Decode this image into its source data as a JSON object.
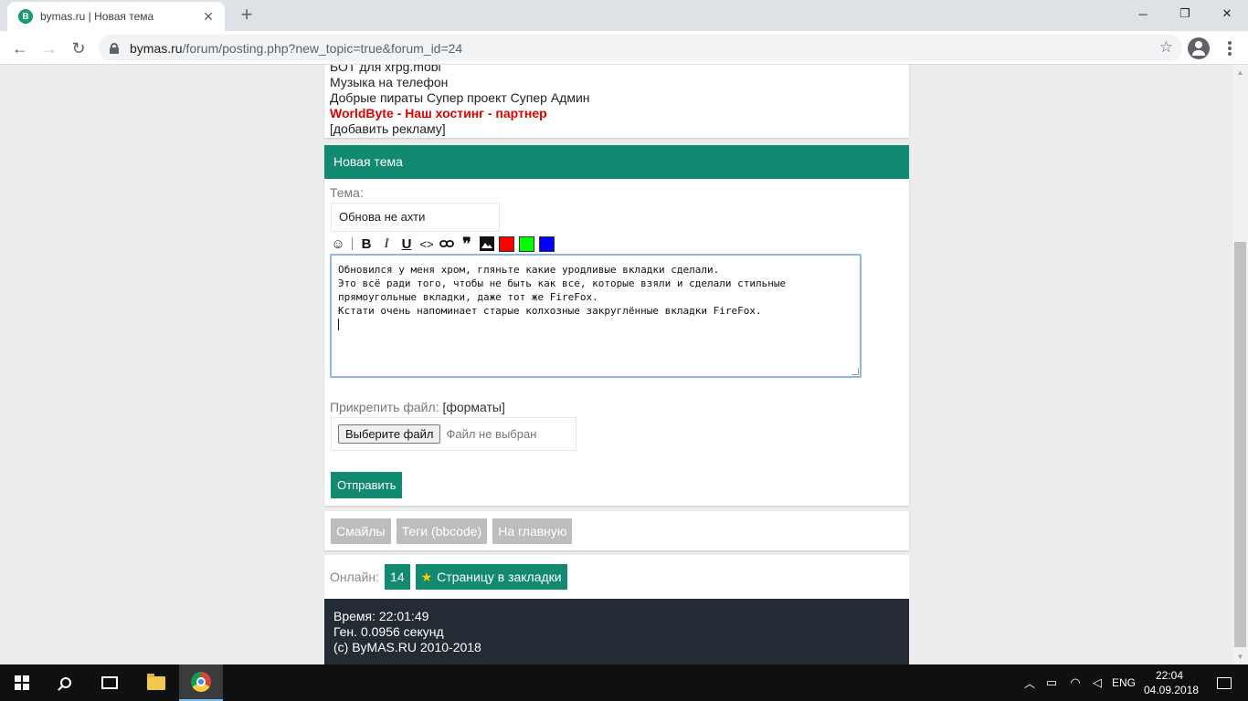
{
  "browser": {
    "tab_title": "bymas.ru | Новая тема",
    "tab_favicon_letter": "B",
    "url_host": "bymas.ru",
    "url_path": "/forum/posting.php?new_topic=true&forum_id=24"
  },
  "ads": {
    "line_cut": "БОТ для xrpg.mobi",
    "line_music": "Музыка на телефон",
    "line_pirates": "Добрые пираты Супер проект Супер Админ",
    "line_worldbyte": "WorldByte - Наш хостинг - партнер",
    "line_add": "[добавить рекламу]"
  },
  "post": {
    "header": "Новая тема",
    "subject_label": "Тема:",
    "subject_value": "Обнова не ахти",
    "message_text": "Обновился у меня хром, гляньте какие уродливые вкладки сделали.\nЭто всё ради того, чтобы не быть как все, которые взяли и сделали стильные прямоугольные вкладки, даже тот же FireFox.\nКстати очень напоминает старые колхозные закруглённые вкладки FireFox.",
    "attach_label": "Прикрепить файл:",
    "attach_formats": "[форматы]",
    "file_button": "Выберите файл",
    "file_status": "Файл не выбран",
    "submit": "Отправить",
    "toolbar": {
      "bold": "B",
      "italic": "I",
      "underline": "U",
      "code": "<>",
      "quote": "❞"
    },
    "swatch_colors": {
      "red": "#ff0000",
      "green": "#00ff00",
      "blue": "#0000ff"
    }
  },
  "links": {
    "smiles": "Смайлы",
    "tags": "Теги (bbcode)",
    "home": "На главную"
  },
  "online": {
    "label": "Онлайн:",
    "count": "14",
    "bookmark": "Страницу в закладки"
  },
  "footer": {
    "time": "Время: 22:01:49",
    "gen": "Ген. 0.0956 секунд",
    "copyright": "(c) ByMAS.RU 2010-2018"
  },
  "taskbar": {
    "language": "ENG",
    "time": "22:04",
    "date": "04.09.2018"
  },
  "colors": {
    "accent": "#128a72",
    "footer_bg": "#232c34",
    "ad_red": "#e00000"
  }
}
